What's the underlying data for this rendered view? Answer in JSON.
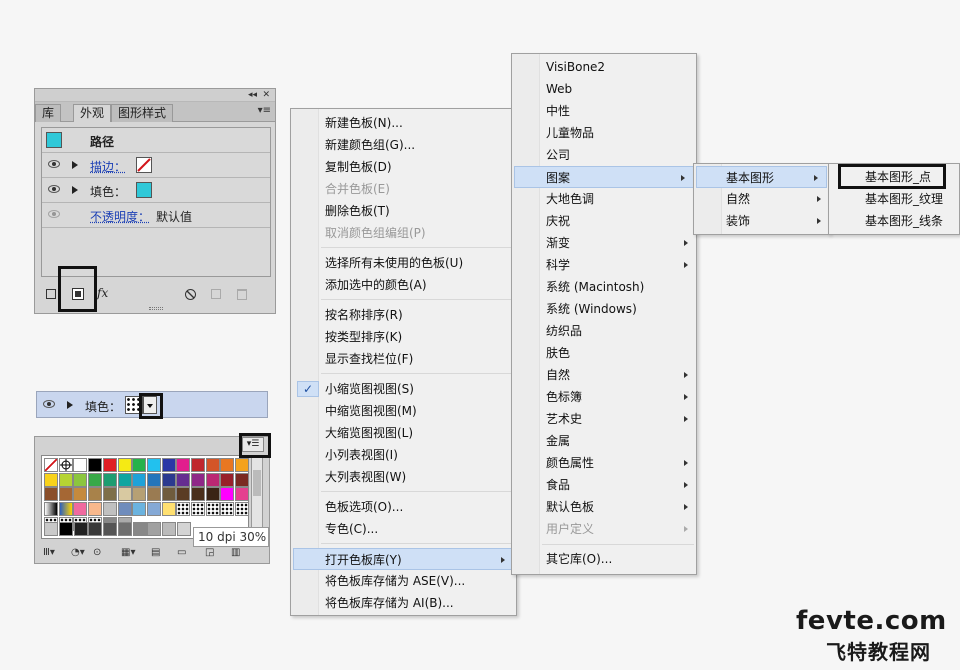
{
  "appearance_panel": {
    "tabs": [
      "库",
      "外观",
      "图形样式"
    ],
    "header": "路径",
    "rows": [
      {
        "label": "描边：",
        "value": ""
      },
      {
        "label": "填色：",
        "value": ""
      },
      {
        "label": "不透明度：",
        "value": "默认值"
      }
    ],
    "fx": "fx"
  },
  "fill_row": {
    "label": "填色："
  },
  "swatch_panel": {
    "tooltip": "10 dpi 30%"
  },
  "main_menu": {
    "items": [
      "新建色板(N)...",
      "新建颜色组(G)...",
      "复制色板(D)",
      "合并色板(E)",
      "删除色板(T)",
      "取消颜色组编组(P)",
      "选择所有未使用的色板(U)",
      "添加选中的颜色(A)",
      "按名称排序(R)",
      "按类型排序(K)",
      "显示查找栏位(F)",
      "小缩览图视图(S)",
      "中缩览图视图(M)",
      "大缩览图视图(L)",
      "小列表视图(I)",
      "大列表视图(W)",
      "色板选项(O)...",
      "专色(C)...",
      "打开色板库(Y)",
      "将色板库存储为 ASE(V)...",
      "将色板库存储为 AI(B)..."
    ]
  },
  "library_menu": {
    "items": [
      "VisiBone2",
      "Web",
      "中性",
      "儿童物品",
      "公司",
      "图案",
      "大地色调",
      "庆祝",
      "渐变",
      "科学",
      "系统 (Macintosh)",
      "系统 (Windows)",
      "纺织品",
      "肤色",
      "自然",
      "色标簿",
      "艺术史",
      "金属",
      "颜色属性",
      "食品",
      "默认色板",
      "用户定义",
      "其它库(O)..."
    ]
  },
  "pattern_menu": {
    "items": [
      "基本图形",
      "自然",
      "装饰"
    ]
  },
  "basic_menu": {
    "items": [
      "基本图形_点",
      "基本图形_纹理",
      "基本图形_线条"
    ]
  },
  "watermark": {
    "line1": "fevte.com",
    "line2": "飞特教程网"
  },
  "colors": {
    "accent": "#2fc8d8",
    "menu_selected": "#cfe0f6"
  }
}
